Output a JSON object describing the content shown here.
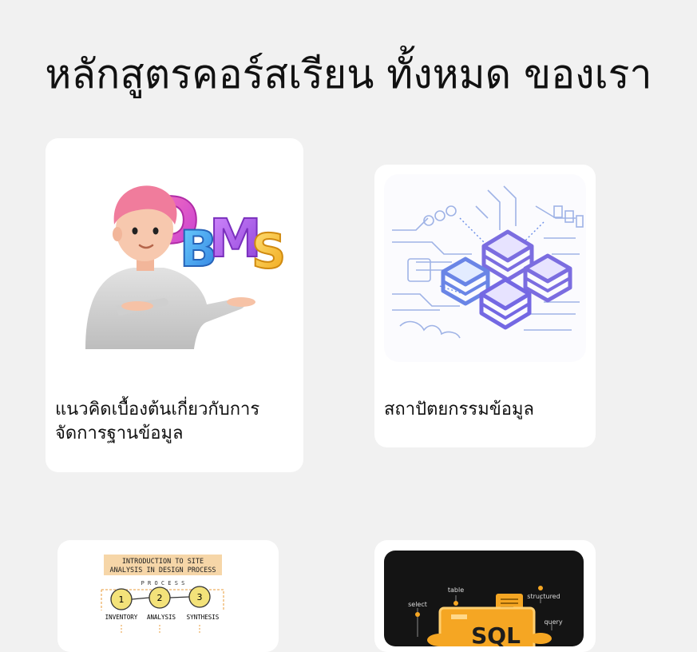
{
  "page": {
    "title": "หลักสูตรคอร์สเรียน ทั้งหมด ของเรา"
  },
  "courses": [
    {
      "title": "แนวคิดเบื้องต้นเกี่ยวกับการจัดการฐานข้อมูล",
      "image": "dbms-3d-character-illustration"
    },
    {
      "title": "สถาปัตยกรรมข้อมูล",
      "image": "data-architecture-isometric-illustration"
    },
    {
      "title": "",
      "image": "site-analysis-sketch-illustration"
    },
    {
      "title": "",
      "image": "sql-database-dark-illustration"
    }
  ],
  "illustrations": {
    "dbms_letters": "DBMS",
    "sketch": {
      "heading": "INTRODUCTION TO SITE ANALYSIS IN DESIGN PROCESS",
      "process": "P R O C E S S",
      "steps": [
        "INVENTORY",
        "ANALYSIS",
        "SYNTHESIS"
      ],
      "numbers": [
        "1",
        "2",
        "3"
      ]
    },
    "sql": {
      "labels": [
        "table",
        "select",
        "structured",
        "query"
      ],
      "logo": "SQL"
    }
  },
  "colors": {
    "background": "#f1f1f1",
    "card": "#ffffff",
    "accent_purple": "#7b6de0",
    "accent_orange": "#f5a623"
  }
}
